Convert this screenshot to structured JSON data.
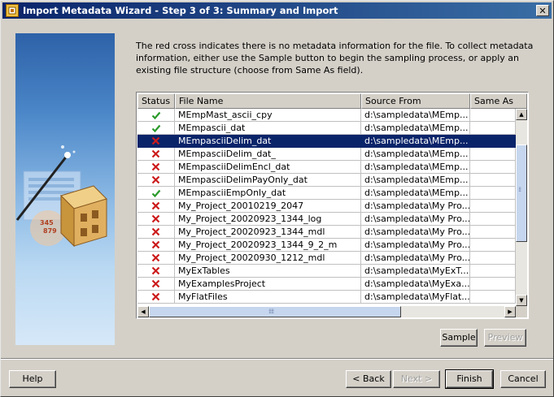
{
  "window": {
    "title": "Import Metadata Wizard - Step 3 of 3: Summary and Import",
    "close_glyph": "✕"
  },
  "intro": {
    "text": "The red cross indicates there is no metadata information for the file. To collect metadata information, either use the Sample button to begin the sampling process, or apply an existing file structure (choose from Same As field)."
  },
  "table": {
    "columns": [
      "Status",
      "File Name",
      "Source From",
      "Same As"
    ],
    "selected_index": 2,
    "rows": [
      {
        "status": "ok",
        "file": "MEmpMast_ascii_cpy",
        "source": "d:\\sampledata\\MEmp...",
        "same_as": ""
      },
      {
        "status": "ok",
        "file": "MEmpascii_dat",
        "source": "d:\\sampledata\\MEmp...",
        "same_as": ""
      },
      {
        "status": "missing",
        "file": "MEmpasciiDelim_dat",
        "source": "d:\\sampledata\\MEmp...",
        "same_as": ""
      },
      {
        "status": "missing",
        "file": "MEmpasciiDelim_dat_",
        "source": "d:\\sampledata\\MEmp...",
        "same_as": ""
      },
      {
        "status": "missing",
        "file": "MEmpasciiDelimEncl_dat",
        "source": "d:\\sampledata\\MEmp...",
        "same_as": ""
      },
      {
        "status": "missing",
        "file": "MEmpasciiDelimPayOnly_dat",
        "source": "d:\\sampledata\\MEmp...",
        "same_as": ""
      },
      {
        "status": "ok",
        "file": "MEmpasciiEmpOnly_dat",
        "source": "d:\\sampledata\\MEmp...",
        "same_as": ""
      },
      {
        "status": "missing",
        "file": "My_Project_20010219_2047",
        "source": "d:\\sampledata\\My Pro...",
        "same_as": ""
      },
      {
        "status": "missing",
        "file": "My_Project_20020923_1344_log",
        "source": "d:\\sampledata\\My Pro...",
        "same_as": ""
      },
      {
        "status": "missing",
        "file": "My_Project_20020923_1344_mdl",
        "source": "d:\\sampledata\\My Pro...",
        "same_as": ""
      },
      {
        "status": "missing",
        "file": "My_Project_20020923_1344_9_2_m",
        "source": "d:\\sampledata\\My Pro...",
        "same_as": ""
      },
      {
        "status": "missing",
        "file": "My_Project_20020930_1212_mdl",
        "source": "d:\\sampledata\\My Pro...",
        "same_as": ""
      },
      {
        "status": "missing",
        "file": "MyExTables",
        "source": "d:\\sampledata\\MyExT...",
        "same_as": ""
      },
      {
        "status": "missing",
        "file": "MyExamplesProject",
        "source": "d:\\sampledata\\MyExa...",
        "same_as": ""
      },
      {
        "status": "missing",
        "file": "MyFlatFiles",
        "source": "d:\\sampledata\\MyFlat...",
        "same_as": ""
      }
    ]
  },
  "buttons": {
    "sample": "Sample",
    "preview": "Preview",
    "help": "Help",
    "back": "< Back",
    "next": "Next >",
    "finish": "Finish",
    "cancel": "Cancel"
  },
  "colors": {
    "ok": "#2a9a2a",
    "missing": "#cc1b1b",
    "selection": "#0a246a",
    "title_start": "#0a246a",
    "title_end": "#3a6ea5"
  },
  "icons": {
    "status_ok": "check-icon",
    "status_missing": "red-cross-icon"
  }
}
